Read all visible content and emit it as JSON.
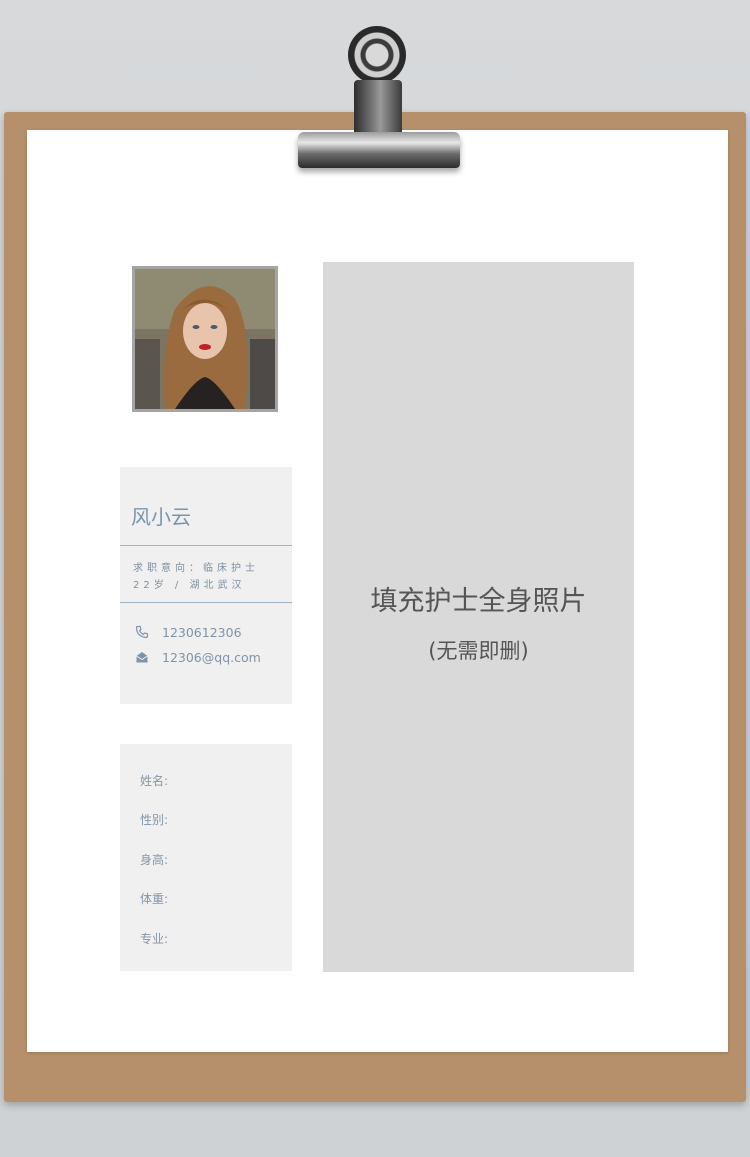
{
  "resume": {
    "name": "风小云",
    "intention": "求职意向：临床护士",
    "age_location": "22岁  /  湖北武汉",
    "phone": "1230612306",
    "email": "12306@qq.com"
  },
  "profile_fields": [
    "姓名:",
    "性别:",
    "身高:",
    "体重:",
    "专业:"
  ],
  "photo_placeholder": {
    "title": "填充护士全身照片",
    "subtitle": "(无需即删)"
  },
  "icons": {
    "phone": "phone-icon",
    "email": "mail-icon"
  },
  "colors": {
    "accent": "#7b94ad",
    "board": "#b5906a",
    "card": "#f0f0f0",
    "placeholder": "#d9d9d9"
  }
}
